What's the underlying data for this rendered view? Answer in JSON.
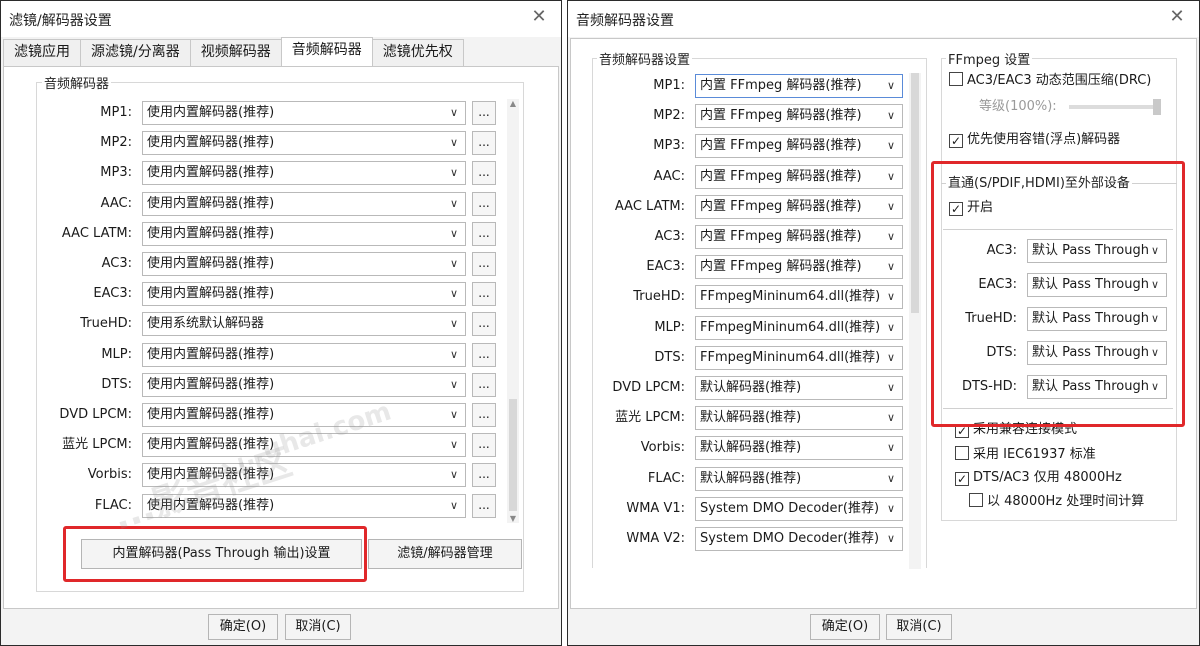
{
  "left_window": {
    "title": "滤镜/解码器设置",
    "tabs": [
      "滤镜应用",
      "源滤镜/分离器",
      "视频解码器",
      "音频解码器",
      "滤镜优先权"
    ],
    "active_tab": 3,
    "group_title": "音频解码器",
    "rows": [
      {
        "label": "MP1:",
        "value": "使用内置解码器(推荐)"
      },
      {
        "label": "MP2:",
        "value": "使用内置解码器(推荐)"
      },
      {
        "label": "MP3:",
        "value": "使用内置解码器(推荐)"
      },
      {
        "label": "AAC:",
        "value": "使用内置解码器(推荐)"
      },
      {
        "label": "AAC LATM:",
        "value": "使用内置解码器(推荐)"
      },
      {
        "label": "AC3:",
        "value": "使用内置解码器(推荐)"
      },
      {
        "label": "EAC3:",
        "value": "使用内置解码器(推荐)"
      },
      {
        "label": "TrueHD:",
        "value": "使用系统默认解码器"
      },
      {
        "label": "MLP:",
        "value": "使用内置解码器(推荐)"
      },
      {
        "label": "DTS:",
        "value": "使用内置解码器(推荐)"
      },
      {
        "label": "DVD LPCM:",
        "value": "使用内置解码器(推荐)"
      },
      {
        "label": "蓝光 LPCM:",
        "value": "使用内置解码器(推荐)"
      },
      {
        "label": "Vorbis:",
        "value": "使用内置解码器(推荐)"
      },
      {
        "label": "FLAC:",
        "value": "使用内置解码器(推荐)"
      }
    ],
    "dots_label": "...",
    "btn_passthrough": "内置解码器(Pass Through 输出)设置",
    "btn_manage": "滤镜/解码器管理",
    "ok": "确定(O)",
    "cancel": "取消(C)",
    "watermark_1": "...uhai.com",
    "watermark_2": "...影音社区"
  },
  "right_window": {
    "title": "音频解码器设置",
    "group_title": "音频解码器设置",
    "rows": [
      {
        "label": "MP1:",
        "value": "内置 FFmpeg 解码器(推荐)"
      },
      {
        "label": "MP2:",
        "value": "内置 FFmpeg 解码器(推荐)"
      },
      {
        "label": "MP3:",
        "value": "内置 FFmpeg 解码器(推荐)"
      },
      {
        "label": "AAC:",
        "value": "内置 FFmpeg 解码器(推荐)"
      },
      {
        "label": "AAC LATM:",
        "value": "内置 FFmpeg 解码器(推荐)"
      },
      {
        "label": "AC3:",
        "value": "内置 FFmpeg 解码器(推荐)"
      },
      {
        "label": "EAC3:",
        "value": "内置 FFmpeg 解码器(推荐)"
      },
      {
        "label": "TrueHD:",
        "value": "FFmpegMininum64.dll(推荐)"
      },
      {
        "label": "MLP:",
        "value": "FFmpegMininum64.dll(推荐)"
      },
      {
        "label": "DTS:",
        "value": "FFmpegMininum64.dll(推荐)"
      },
      {
        "label": "DVD LPCM:",
        "value": "默认解码器(推荐)"
      },
      {
        "label": "蓝光 LPCM:",
        "value": "默认解码器(推荐)"
      },
      {
        "label": "Vorbis:",
        "value": "默认解码器(推荐)"
      },
      {
        "label": "FLAC:",
        "value": "默认解码器(推荐)"
      },
      {
        "label": "WMA V1:",
        "value": "System DMO Decoder(推荐)"
      },
      {
        "label": "WMA V2:",
        "value": "System DMO Decoder(推荐)"
      }
    ],
    "ffmpeg_title": "FFmpeg 设置",
    "drc_label": "AC3/EAC3 动态范围压缩(DRC)",
    "drc_checked": false,
    "level_label": "等级(100%):",
    "level_value": 1.0,
    "prefer_float_label": "优先使用容错(浮点)解码器",
    "prefer_float_checked": true,
    "passthrough_title": "直通(S/PDIF,HDMI)至外部设备",
    "enable_label": "开启",
    "enable_checked": true,
    "pt_rows": [
      {
        "label": "AC3:",
        "value": "默认 Pass Through"
      },
      {
        "label": "EAC3:",
        "value": "默认 Pass Through"
      },
      {
        "label": "TrueHD:",
        "value": "默认 Pass Through"
      },
      {
        "label": "DTS:",
        "value": "默认 Pass Through"
      },
      {
        "label": "DTS-HD:",
        "value": "默认 Pass Through"
      }
    ],
    "compat_label": "采用兼容连接模式",
    "compat_checked": true,
    "iec_label": "采用 IEC61937 标准",
    "iec_checked": false,
    "dts48_label": "DTS/AC3 仅用 48000Hz",
    "dts48_checked": true,
    "calc48_label": "以 48000Hz 处理时间计算",
    "calc48_checked": false,
    "ok": "确定(O)",
    "cancel": "取消(C)"
  },
  "icons": {
    "close": "✕",
    "arrow": "∨",
    "check": "✓"
  },
  "colors": {
    "highlight": "#e0282a"
  }
}
